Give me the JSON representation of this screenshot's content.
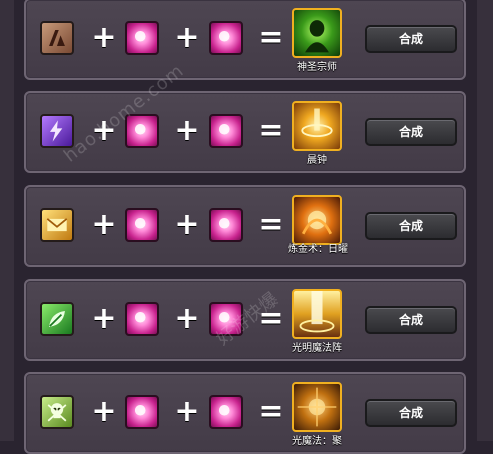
{
  "operators": {
    "plus": "+",
    "equals": "="
  },
  "recipes": [
    {
      "input_rune": "brown-rune-icon",
      "result_name": "神圣宗师",
      "button_label": "合成"
    },
    {
      "input_rune": "purple-lightning-rune-icon",
      "result_name": "晨钟",
      "button_label": "合成"
    },
    {
      "input_rune": "gold-envelope-rune-icon",
      "result_name": "炼金术：日曜",
      "button_label": "合成"
    },
    {
      "input_rune": "green-leaf-rune-icon",
      "result_name": "光明魔法阵",
      "button_label": "合成"
    },
    {
      "input_rune": "skull-rune-icon",
      "result_name": "光魔法：聚",
      "button_label": "合成"
    }
  ],
  "watermark": {
    "text_1": "hao.home.com",
    "text_2": "好游快爆"
  }
}
